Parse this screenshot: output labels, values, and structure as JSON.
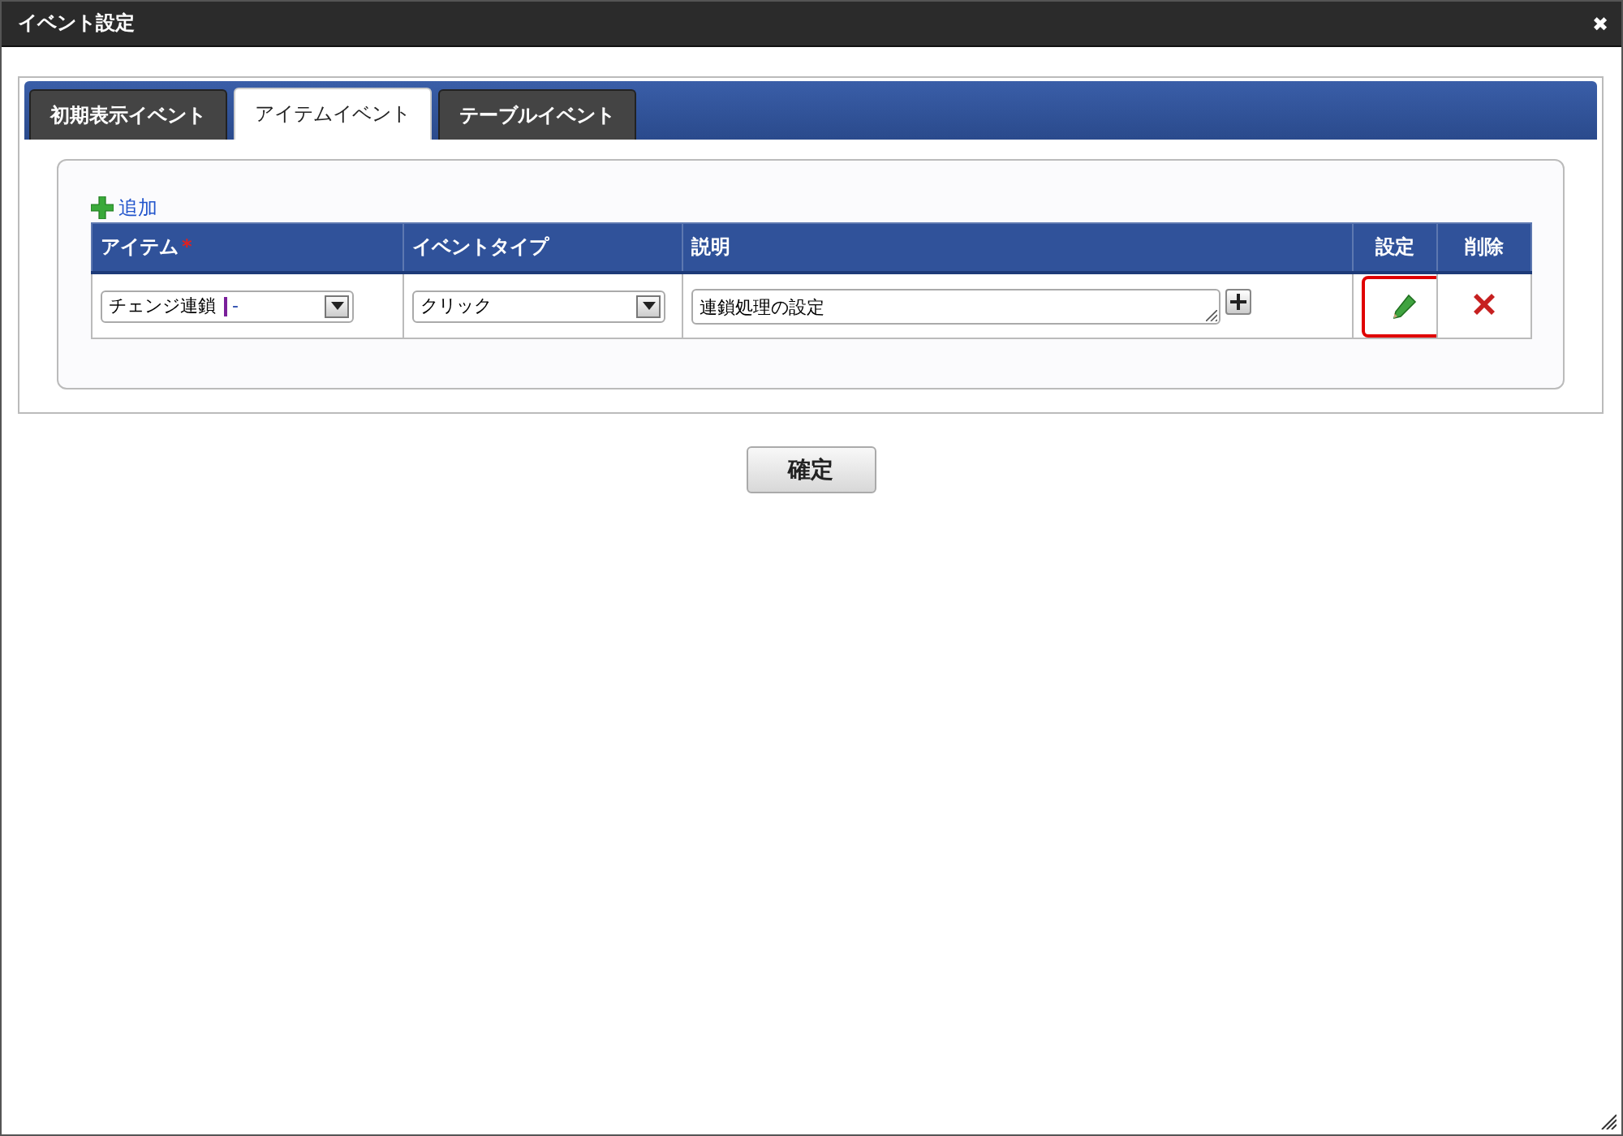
{
  "window": {
    "title": "イベント設定",
    "close": "✖"
  },
  "tabs": [
    {
      "label": "初期表示イベント",
      "selected": false
    },
    {
      "label": "アイテムイベント",
      "selected": true
    },
    {
      "label": "テーブルイベント",
      "selected": false
    }
  ],
  "add_link": "追加",
  "table": {
    "columns": [
      {
        "label": "アイテム",
        "required_mark": "*"
      },
      {
        "label": "イベントタイプ"
      },
      {
        "label": "説明"
      },
      {
        "label": "設定"
      },
      {
        "label": "削除"
      }
    ],
    "rows": [
      {
        "item": "チェンジ連鎖",
        "item_suffix": "-",
        "event_type": "クリック",
        "description": "連鎖処理の設定",
        "settings_highlighted": true
      }
    ]
  },
  "confirm_button": "確定"
}
